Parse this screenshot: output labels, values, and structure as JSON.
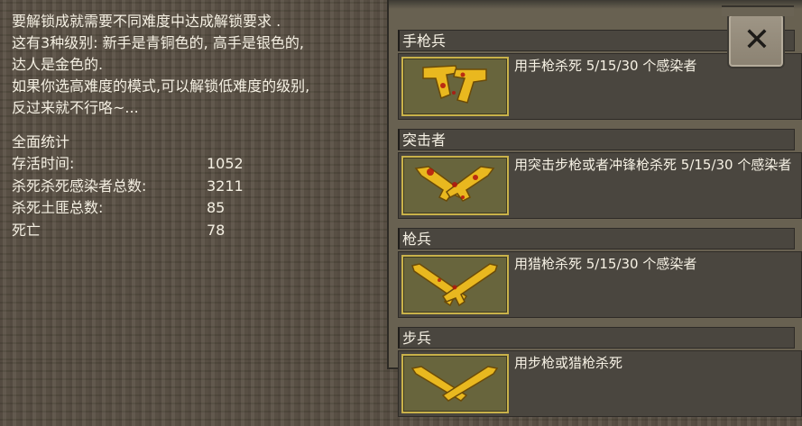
{
  "intro": {
    "lines": [
      "要解锁成就需要不同难度中达成解锁要求 .",
      "这有3种级别: 新手是青铜色的, 高手是银色的,",
      "达人是金色的.",
      "如果你选高难度的模式,可以解锁低难度的级别,",
      "反过来就不行咯~..."
    ]
  },
  "stats": {
    "title": "全面统计",
    "rows": [
      {
        "label": "存活时间:",
        "value": "1052"
      },
      {
        "label": "杀死杀死感染者总数:",
        "value": "3211"
      },
      {
        "label": "杀死土匪总数:",
        "value": "85"
      },
      {
        "label": "死亡",
        "value": "78"
      }
    ]
  },
  "achievements": [
    {
      "title": "手枪兵",
      "desc": "用手枪杀死 5/15/30 个感染者",
      "icon": "pistols-icon"
    },
    {
      "title": "突击者",
      "desc": "用突击步枪或者冲锋枪杀死 5/15/30 个感染者",
      "icon": "assault-rifles-icon"
    },
    {
      "title": "枪兵",
      "desc": "用猎枪杀死 5/15/30 个感染者",
      "icon": "shotguns-icon"
    },
    {
      "title": "步兵",
      "desc": "用步枪或猎枪杀死",
      "icon": "rifles-icon"
    }
  ],
  "close_icon": "close-icon",
  "close_glyph": "✕",
  "colors": {
    "text": "#f4efe2",
    "panel": "#686151",
    "row_bg": "#4a463f",
    "gold_frame": "#c9b24a",
    "icon_bg": "#68653d"
  }
}
